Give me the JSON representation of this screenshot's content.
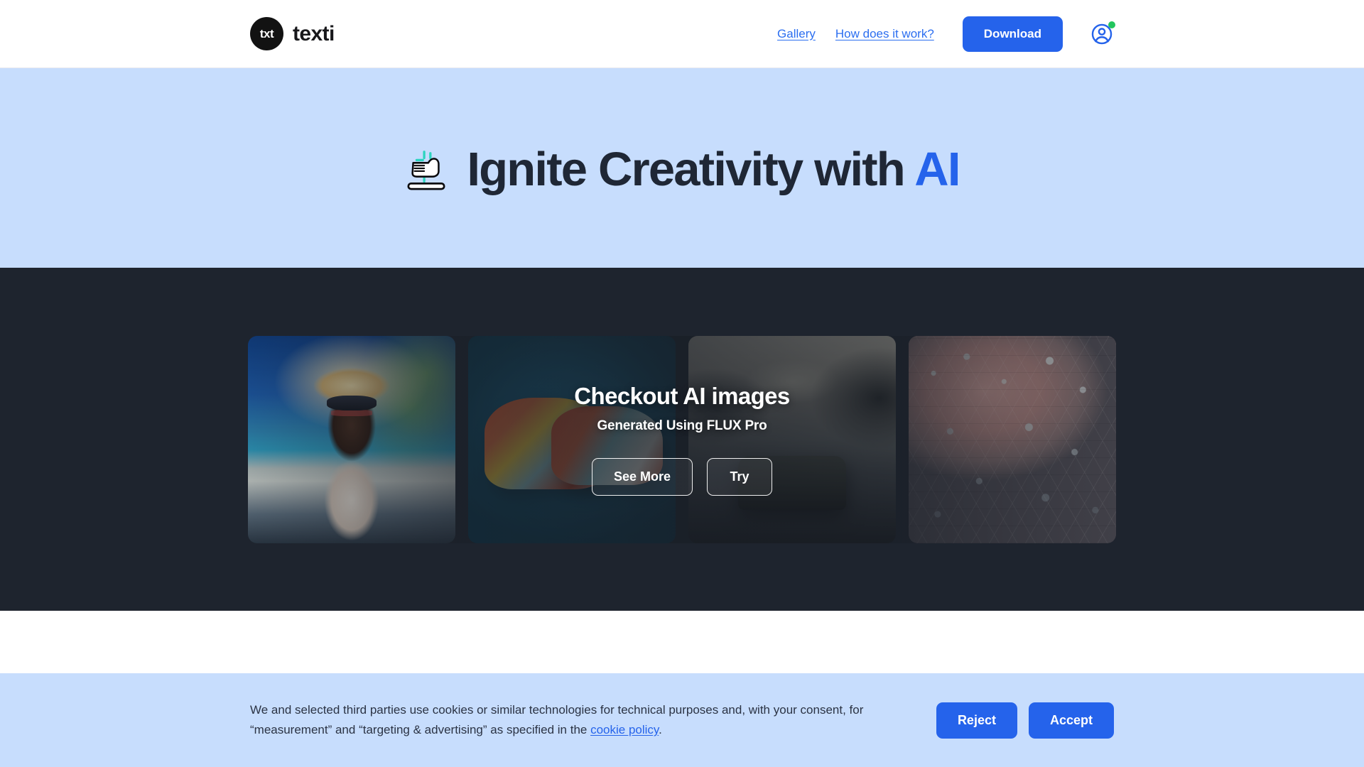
{
  "header": {
    "brand": {
      "mark_text": "txt",
      "name": "texti"
    },
    "nav": [
      {
        "label": "Gallery",
        "name": "nav-link-gallery"
      },
      {
        "label": "How does it work?",
        "name": "nav-link-how-does-it-work"
      }
    ],
    "download_label": "Download",
    "account_icon": "user-circle-icon",
    "status_dot_color": "#22c55e"
  },
  "hero": {
    "icon": "magic-hand-icon",
    "title_main": "Ignite Creativity with",
    "title_accent": "AI",
    "accent_color": "#2563eb",
    "background_color": "#c7ddfd"
  },
  "gallery": {
    "background_color": "#1e242e",
    "overlay_title": "Checkout AI images",
    "overlay_subtitle": "Generated Using FLUX Pro",
    "buttons": [
      {
        "label": "See More",
        "name": "see-more-button"
      },
      {
        "label": "Try",
        "name": "try-button"
      }
    ],
    "tiles": [
      {
        "name": "gallery-tile-beach-woman",
        "alt": "Woman in straw sun hat and sunglasses on a tropical beach"
      },
      {
        "name": "gallery-tile-sneakers",
        "alt": "Colorful high-top sneakers on a teal background"
      },
      {
        "name": "gallery-tile-car",
        "alt": "Dark classic car driving on a mountain road"
      },
      {
        "name": "gallery-tile-molecular",
        "alt": "Abstract molecular honeycomb structure in pink and grey"
      }
    ]
  },
  "cookie_banner": {
    "background_color": "#c7ddfd",
    "text_part1": "We and selected third parties use cookies or similar technologies for technical purposes and, with your consent, for “measurement” and “targeting & advertising” as specified in the ",
    "link_label": "cookie policy",
    "text_part2": ".",
    "reject_label": "Reject",
    "accept_label": "Accept"
  }
}
